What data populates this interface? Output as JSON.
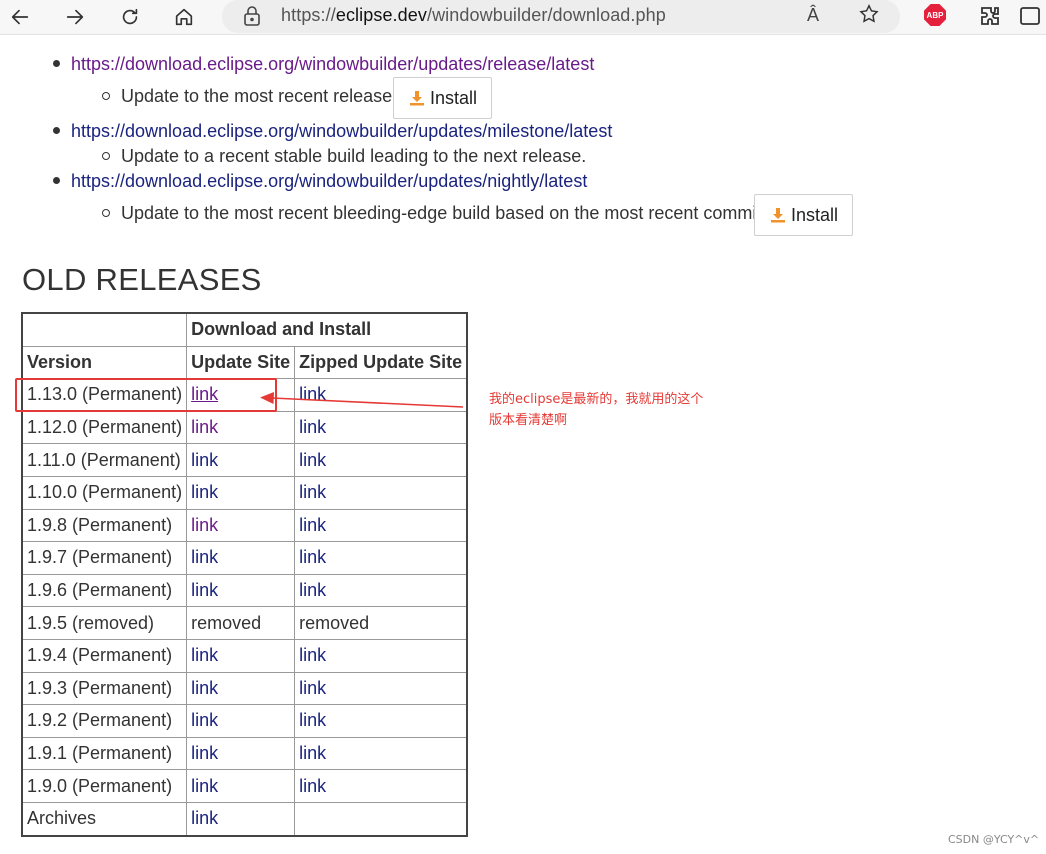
{
  "browser": {
    "url_prefix": "https://",
    "url_host": "eclipse.dev",
    "url_path": "/windowbuilder/download.php",
    "read_aloud_glyph": "Â",
    "abp_label": "ABP"
  },
  "updates": {
    "items": [
      {
        "url": "https://download.eclipse.org/windowbuilder/updates/release/latest",
        "desc": "Update to the most recent release.",
        "install_label": "Install"
      },
      {
        "url": "https://download.eclipse.org/windowbuilder/updates/milestone/latest",
        "desc": "Update to a recent stable build leading to the next release."
      },
      {
        "url": "https://download.eclipse.org/windowbuilder/updates/nightly/latest",
        "desc": "Update to the most recent bleeding-edge build based on the most recent commit.",
        "install_label": "Install"
      }
    ]
  },
  "old_releases": {
    "heading": "OLD RELEASES",
    "group_header": "Download and Install",
    "headers": [
      "Version",
      "Update Site",
      "Zipped Update Site"
    ],
    "rows": [
      [
        "1.13.0 (Permanent)",
        "link",
        "link"
      ],
      [
        "1.12.0 (Permanent)",
        "link",
        "link"
      ],
      [
        "1.11.0 (Permanent)",
        "link",
        "link"
      ],
      [
        "1.10.0 (Permanent)",
        "link",
        "link"
      ],
      [
        "1.9.8 (Permanent)",
        "link",
        "link"
      ],
      [
        "1.9.7 (Permanent)",
        "link",
        "link"
      ],
      [
        "1.9.6 (Permanent)",
        "link",
        "link"
      ],
      [
        "1.9.5 (removed)",
        "removed",
        "removed"
      ],
      [
        "1.9.4 (Permanent)",
        "link",
        "link"
      ],
      [
        "1.9.3 (Permanent)",
        "link",
        "link"
      ],
      [
        "1.9.2 (Permanent)",
        "link",
        "link"
      ],
      [
        "1.9.1 (Permanent)",
        "link",
        "link"
      ],
      [
        "1.9.0 (Permanent)",
        "link",
        "link"
      ],
      [
        "Archives",
        "link",
        ""
      ]
    ]
  },
  "annotation": {
    "line1": "我的eclipse是最新的，我就用的这个",
    "line2": "版本看清楚啊",
    "color": "#e53935"
  },
  "watermark": "CSDN @YCY^v^",
  "colors": {
    "visited_link": "#6a1b8a",
    "link": "#1a237e",
    "install_icon": "#f0932b"
  }
}
